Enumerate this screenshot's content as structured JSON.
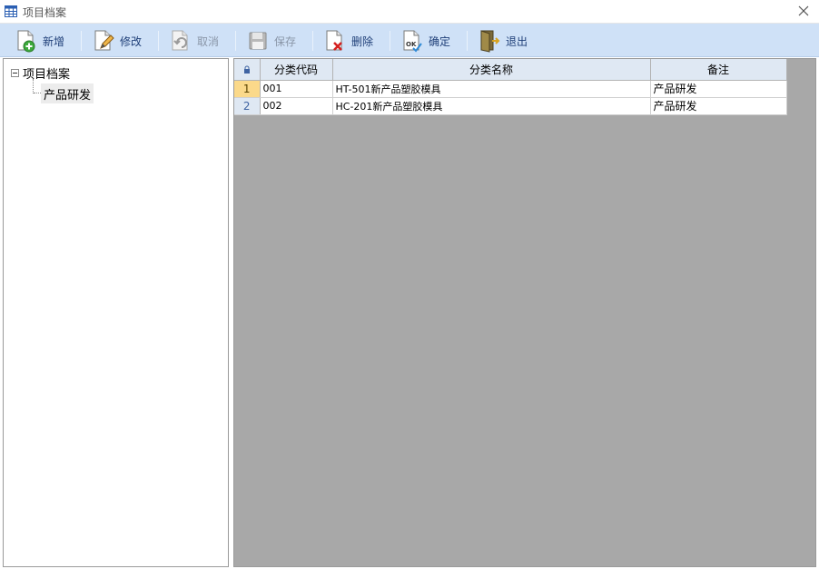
{
  "window": {
    "title": "项目档案",
    "app_icon": "table-icon",
    "close_icon": "close-icon"
  },
  "toolbar": {
    "buttons": [
      {
        "label": "新增",
        "icon": "new-doc-icon",
        "enabled": true
      },
      {
        "label": "修改",
        "icon": "edit-icon",
        "enabled": true
      },
      {
        "label": "取消",
        "icon": "undo-icon",
        "enabled": false
      },
      {
        "label": "保存",
        "icon": "save-icon",
        "enabled": false
      },
      {
        "label": "删除",
        "icon": "delete-icon",
        "enabled": true
      },
      {
        "label": "确定",
        "icon": "ok-icon",
        "enabled": true
      },
      {
        "label": "退出",
        "icon": "exit-icon",
        "enabled": true
      }
    ]
  },
  "tree": {
    "root": {
      "label": "项目档案",
      "expanded": true
    },
    "children": [
      {
        "label": "产品研发",
        "selected": true
      }
    ]
  },
  "grid": {
    "columns": [
      "分类代码",
      "分类名称",
      "备注"
    ],
    "rows": [
      {
        "num": "1",
        "code": "001",
        "name": "HT-501新产品塑胶模具",
        "note": "产品研发",
        "selected": true
      },
      {
        "num": "2",
        "code": "002",
        "name": "HC-201新产品塑胶模具",
        "note": "产品研发",
        "selected": false
      }
    ]
  }
}
